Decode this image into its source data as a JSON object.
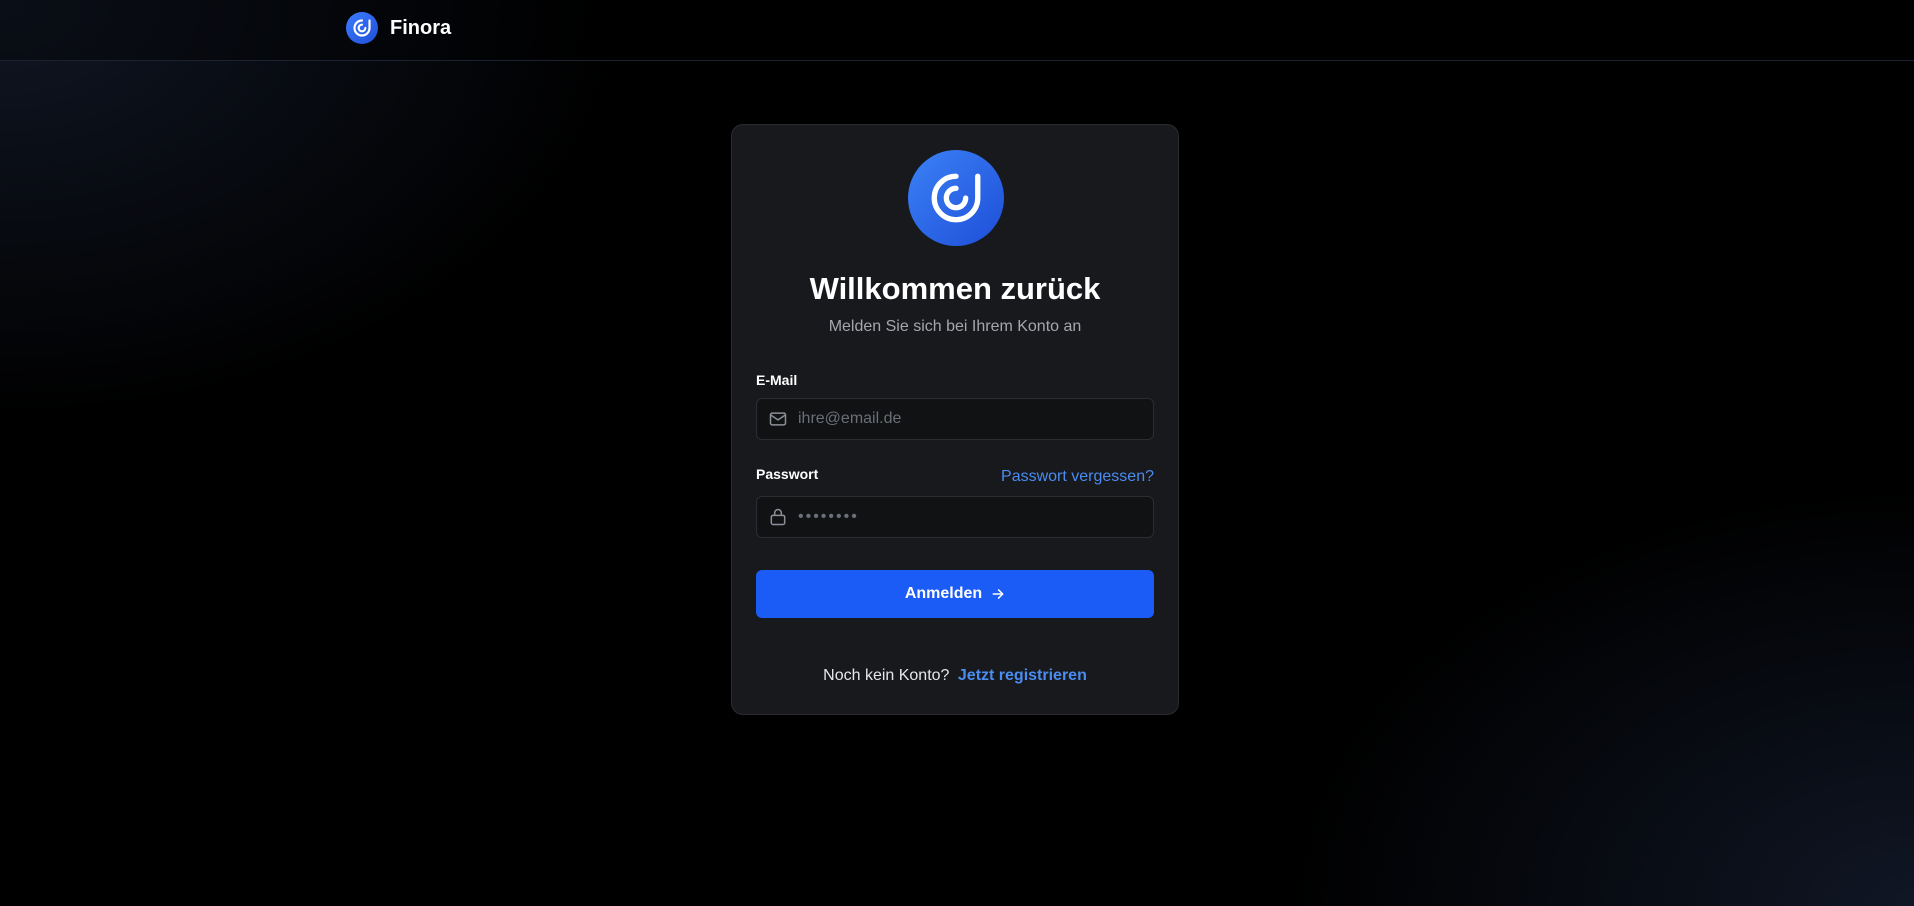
{
  "header": {
    "brand_name": "Finora",
    "logo_icon": "finora-logo-icon"
  },
  "login": {
    "title": "Willkommen zurück",
    "subtitle": "Melden Sie sich bei Ihrem Konto an",
    "email_label": "E-Mail",
    "email_placeholder": "ihre@email.de",
    "email_value": "",
    "password_label": "Passwort",
    "password_placeholder": "••••••••",
    "password_value": "",
    "forgot_password": "Passwort vergessen?",
    "submit_label": "Anmelden",
    "no_account_text": "Noch kein Konto?",
    "register_link": "Jetzt registrieren"
  },
  "icons": {
    "email": "mail-icon",
    "password": "lock-icon",
    "submit": "arrow-right-icon"
  },
  "colors": {
    "accent": "#1a5cf5",
    "link": "#4a8cf0",
    "card_background": "#18191c",
    "page_background": "#000000"
  }
}
